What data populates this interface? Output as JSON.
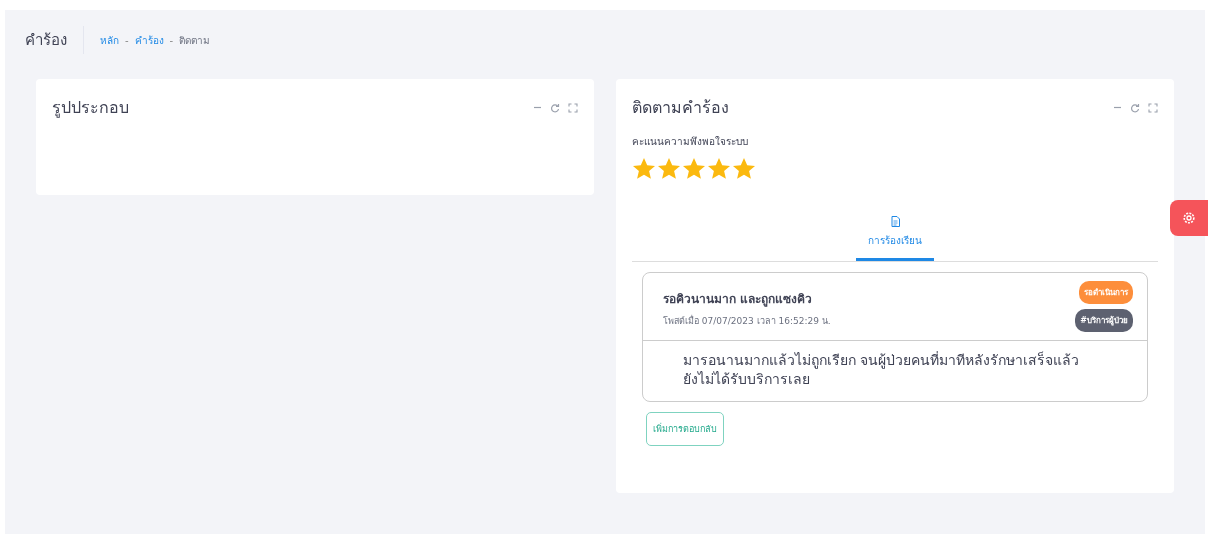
{
  "page_title": "คำร้อง",
  "breadcrumb": [
    {
      "label": "หลัก",
      "link": true
    },
    {
      "separator": "-",
      "label": "คำร้อง",
      "link": true
    },
    {
      "separator": "-",
      "label": "ติดตาม",
      "link": false
    }
  ],
  "photo_card": {
    "title": "รูปประกอบ"
  },
  "tracking_card": {
    "title": "ติดตามคำร้อง",
    "rating_label": "คะแนนความพึงพอใจระบบ",
    "stars": 5,
    "tabs": [
      {
        "label": "การร้องเรียน",
        "selected": true
      }
    ],
    "complaint": {
      "title": "รอคิวนานมาก และถูกแซงคิว",
      "posted": "โพสต์เมื่อ 07/07/2023 เวลา 16:52:29 น.",
      "badges": [
        {
          "label": "รอดำเนินการ",
          "color": "#fd8e3b"
        },
        {
          "label": "#บริการผู้ป่วย",
          "color": "#5d6170"
        }
      ],
      "body": "มารอนานมากแล้วไม่ถูกเรียก จนผู้ป่วยคนที่มาทีหลังรักษาเสร็จแล้ว ยังไม่ได้รับบริการเลย"
    },
    "reply_button": "เพิ่มการตอบกลับ"
  }
}
